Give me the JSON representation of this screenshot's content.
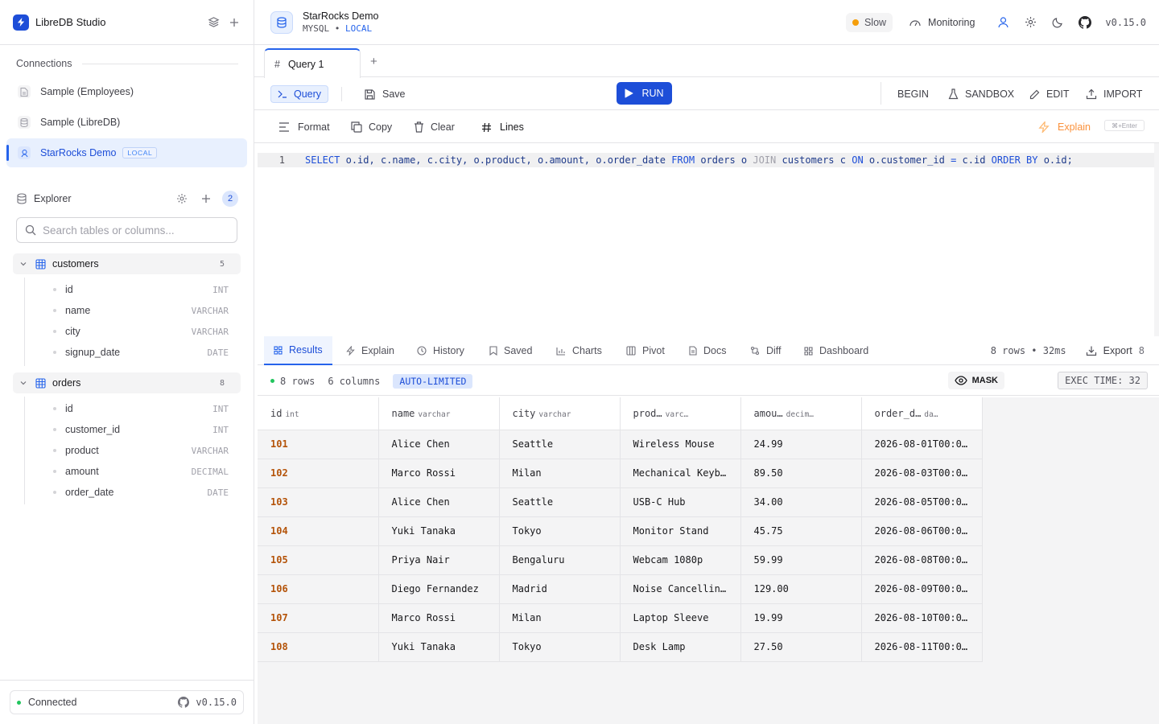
{
  "app": {
    "title": "LibreDB Studio"
  },
  "sidebar": {
    "connections_label": "Connections",
    "connections": [
      {
        "label": "Sample (Employees)",
        "active": false
      },
      {
        "label": "Sample (LibreDB)",
        "active": false
      },
      {
        "label": "StarRocks Demo",
        "active": true,
        "badge": "LOCAL"
      }
    ],
    "explorer": {
      "label": "Explorer",
      "count": "2",
      "search_placeholder": "Search tables or columns..."
    },
    "tables": [
      {
        "name": "customers",
        "count": "5",
        "columns": [
          {
            "name": "id",
            "type": "INT"
          },
          {
            "name": "name",
            "type": "VARCHAR"
          },
          {
            "name": "city",
            "type": "VARCHAR"
          },
          {
            "name": "signup_date",
            "type": "DATE"
          }
        ]
      },
      {
        "name": "orders",
        "count": "8",
        "columns": [
          {
            "name": "id",
            "type": "INT"
          },
          {
            "name": "customer_id",
            "type": "INT"
          },
          {
            "name": "product",
            "type": "VARCHAR"
          },
          {
            "name": "amount",
            "type": "DECIMAL"
          },
          {
            "name": "order_date",
            "type": "DATE"
          }
        ]
      }
    ],
    "footer": {
      "status": "Connected",
      "version": "v0.15.0"
    }
  },
  "header": {
    "db_name": "StarRocks Demo",
    "db_type": "MYSQL",
    "db_env": "LOCAL",
    "slow_label": "Slow",
    "monitoring_label": "Monitoring",
    "version": "v0.15.0"
  },
  "tabs": {
    "query_tab": "Query 1"
  },
  "toolbar": {
    "query": "Query",
    "save": "Save",
    "run": "RUN",
    "begin": "BEGIN",
    "sandbox": "SANDBOX",
    "edit": "EDIT",
    "import": "IMPORT"
  },
  "toolbar2": {
    "format": "Format",
    "copy": "Copy",
    "clear": "Clear",
    "lines": "Lines",
    "explain": "Explain",
    "shortcut": "⌘+Enter"
  },
  "editor": {
    "line_number": "1"
  },
  "results": {
    "tabs": [
      "Results",
      "Explain",
      "History",
      "Saved",
      "Charts",
      "Pivot",
      "Docs",
      "Diff",
      "Dashboard"
    ],
    "meta": "8 rows • 32ms",
    "export": "Export",
    "export_count": "8",
    "rows_label": "8 rows",
    "cols_label": "6 columns",
    "auto_limited": "AUTO-LIMITED",
    "mask": "MASK",
    "exec_time": "EXEC TIME: 32",
    "columns": [
      {
        "name": "id",
        "type": "int"
      },
      {
        "name": "name",
        "type": "varchar"
      },
      {
        "name": "city",
        "type": "varchar"
      },
      {
        "name": "prod…",
        "type": "varc…"
      },
      {
        "name": "amou…",
        "type": "decim…"
      },
      {
        "name": "order_d…",
        "type": "da…"
      }
    ],
    "rows": [
      [
        "101",
        "Alice Chen",
        "Seattle",
        "Wireless Mouse",
        "24.99",
        "2026-08-01T00:0…"
      ],
      [
        "102",
        "Marco Rossi",
        "Milan",
        "Mechanical Keyb…",
        "89.50",
        "2026-08-03T00:0…"
      ],
      [
        "103",
        "Alice Chen",
        "Seattle",
        "USB-C Hub",
        "34.00",
        "2026-08-05T00:0…"
      ],
      [
        "104",
        "Yuki Tanaka",
        "Tokyo",
        "Monitor Stand",
        "45.75",
        "2026-08-06T00:0…"
      ],
      [
        "105",
        "Priya Nair",
        "Bengaluru",
        "Webcam 1080p",
        "59.99",
        "2026-08-08T00:0…"
      ],
      [
        "106",
        "Diego Fernandez",
        "Madrid",
        "Noise Cancellin…",
        "129.00",
        "2026-08-09T00:0…"
      ],
      [
        "107",
        "Marco Rossi",
        "Milan",
        "Laptop Sleeve",
        "19.99",
        "2026-08-10T00:0…"
      ],
      [
        "108",
        "Yuki Tanaka",
        "Tokyo",
        "Desk Lamp",
        "27.50",
        "2026-08-11T00:0…"
      ]
    ]
  },
  "colors": {
    "accent": "#1d4ed8",
    "active_bg": "#e8f0fe",
    "id_color": "#b45309",
    "slow": "#f59e0b",
    "connected": "#22c55e"
  }
}
